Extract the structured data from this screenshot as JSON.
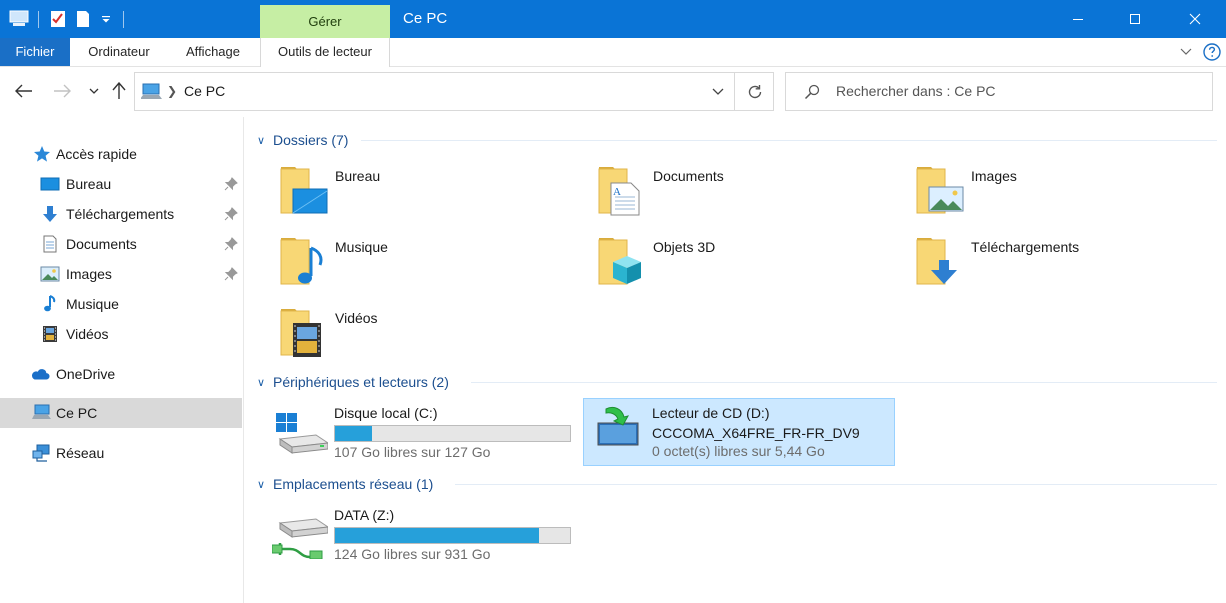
{
  "titlebar": {
    "context_group": "Gérer",
    "title": "Ce PC",
    "accent": "#0a74d6"
  },
  "ribbon": {
    "tabs": [
      "Fichier",
      "Ordinateur",
      "Affichage",
      "Outils de lecteur"
    ]
  },
  "address": {
    "path": "Ce PC",
    "search_placeholder": "Rechercher dans : Ce PC"
  },
  "sidebar": {
    "items": [
      {
        "label": "Accès rapide",
        "icon": "star-icon"
      },
      {
        "label": "Bureau",
        "icon": "desktop-icon",
        "pinned": true
      },
      {
        "label": "Téléchargements",
        "icon": "download-arrow-icon",
        "pinned": true
      },
      {
        "label": "Documents",
        "icon": "document-icon",
        "pinned": true
      },
      {
        "label": "Images",
        "icon": "picture-icon",
        "pinned": true
      },
      {
        "label": "Musique",
        "icon": "music-note-icon"
      },
      {
        "label": "Vidéos",
        "icon": "film-icon"
      },
      {
        "label": "OneDrive",
        "icon": "cloud-icon"
      },
      {
        "label": "Ce PC",
        "icon": "computer-icon",
        "selected": true
      },
      {
        "label": "Réseau",
        "icon": "network-icon"
      }
    ]
  },
  "groups": {
    "folders": "Dossiers (7)",
    "devices": "Périphériques et lecteurs (2)",
    "network": "Emplacements réseau (1)"
  },
  "folders": [
    {
      "label": "Bureau",
      "icon": "desktop-folder-icon"
    },
    {
      "label": "Documents",
      "icon": "documents-folder-icon"
    },
    {
      "label": "Images",
      "icon": "pictures-folder-icon"
    },
    {
      "label": "Musique",
      "icon": "music-folder-icon"
    },
    {
      "label": "Objets 3D",
      "icon": "3d-objects-folder-icon"
    },
    {
      "label": "Téléchargements",
      "icon": "downloads-folder-icon"
    },
    {
      "label": "Vidéos",
      "icon": "videos-folder-icon"
    }
  ],
  "drives": [
    {
      "name": "Disque local (C:)",
      "free": "107 Go libres sur 127 Go",
      "used_fraction": 0.157,
      "icon": "windows-drive-icon"
    },
    {
      "name": "Lecteur de CD (D:)",
      "label": "CCCOMA_X64FRE_FR-FR_DV9",
      "free": "0 octet(s) libres sur 5,44 Go",
      "icon": "cd-drive-icon",
      "selected": true
    }
  ],
  "network_drives": [
    {
      "name": "DATA (Z:)",
      "free": "124 Go libres sur 931 Go",
      "used_fraction": 0.867,
      "icon": "network-drive-icon"
    }
  ],
  "colors": {
    "usage_bar": "#26a0da",
    "selection": "#cce8ff"
  }
}
